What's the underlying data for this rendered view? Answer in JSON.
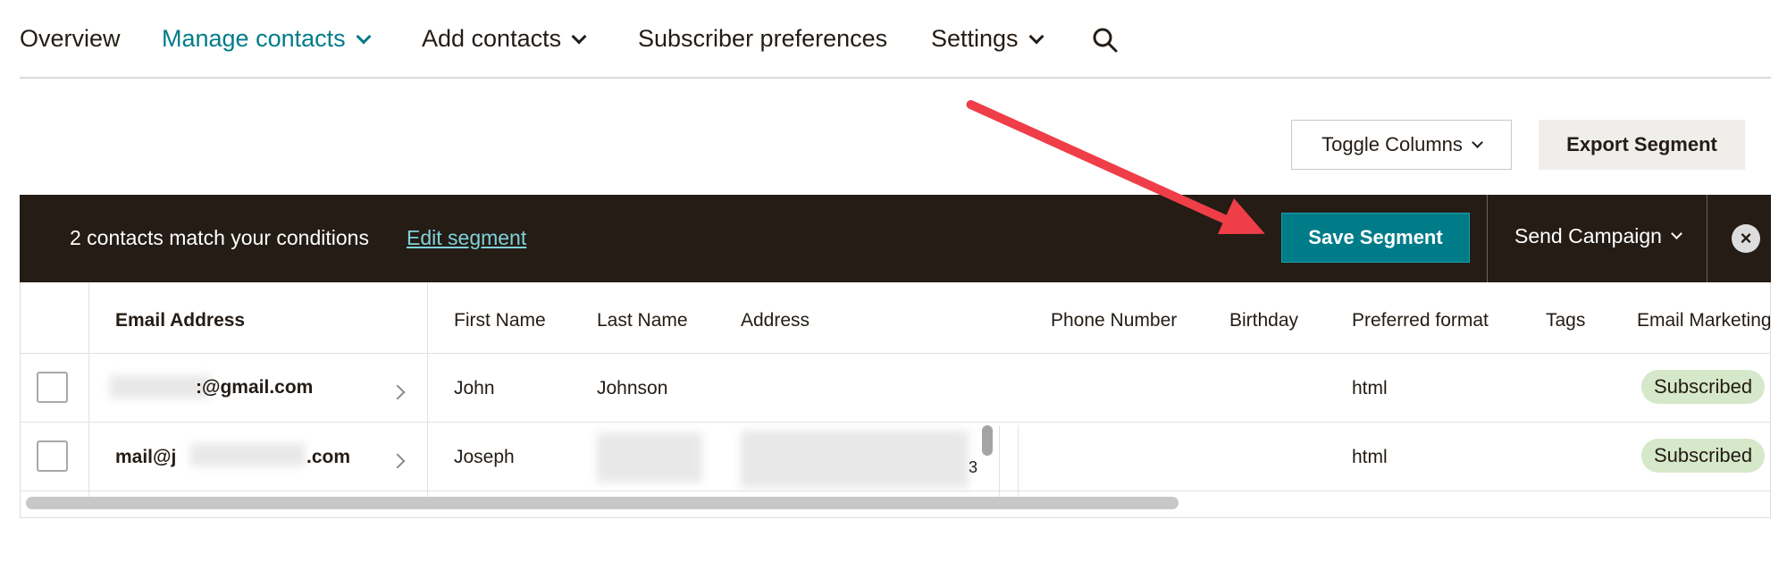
{
  "nav": {
    "items": [
      {
        "label": "Overview"
      },
      {
        "label": "Manage contacts"
      },
      {
        "label": "Add contacts"
      },
      {
        "label": "Subscriber preferences"
      },
      {
        "label": "Settings"
      }
    ]
  },
  "toolbar": {
    "toggle_columns": "Toggle Columns",
    "export_segment": "Export Segment"
  },
  "segment_bar": {
    "match_text": "2 contacts match your conditions",
    "edit_link": "Edit segment",
    "save_button": "Save Segment",
    "send_campaign": "Send Campaign"
  },
  "table": {
    "headers": [
      "Email Address",
      "First Name",
      "Last Name",
      "Address",
      "Phone Number",
      "Birthday",
      "Preferred format",
      "Tags",
      "Email Marketing"
    ],
    "rows": [
      {
        "email": ":@gmail.com",
        "first_name": "John",
        "last_name": "Johnson",
        "address": "",
        "phone": "",
        "birthday": "",
        "format": "html",
        "tags": "",
        "status": "Subscribed"
      },
      {
        "email_prefix": "mail@j",
        "email_suffix": ".com",
        "first_name": "Joseph",
        "address_fragment": "3",
        "format": "html",
        "status": "Subscribed"
      }
    ]
  },
  "colors": {
    "accent": "#007c89",
    "band": "#241c15",
    "subscribed_badge": "#d5e8c9",
    "annotation_arrow": "#ef3e48"
  }
}
